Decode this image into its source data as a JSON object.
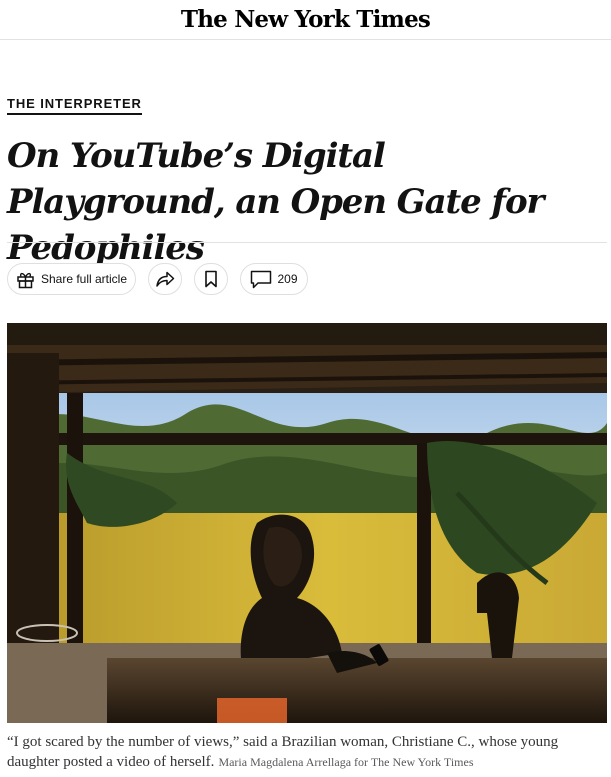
{
  "masthead": {
    "logo_text": "The New York Times"
  },
  "article": {
    "kicker": "THE INTERPRETER",
    "headline": "On YouTube’s Digital Playground, an Open Gate for Pedophiles"
  },
  "actions": {
    "share_label": "Share full article",
    "comment_count": "209",
    "icons": [
      "gift-icon",
      "forward-arrow-icon",
      "bookmark-icon",
      "comment-bubble-icon"
    ]
  },
  "photo": {
    "caption": "“I got scared by the number of views,” said a Brazilian woman, Christiane C., whose young daughter posted a video of herself.",
    "credit": "Maria Magdalena Arrellaga for The New York Times"
  },
  "colors": {
    "text": "#121212",
    "rule": "#e2e2e2",
    "wall_yellow": "#d9bc3a"
  }
}
